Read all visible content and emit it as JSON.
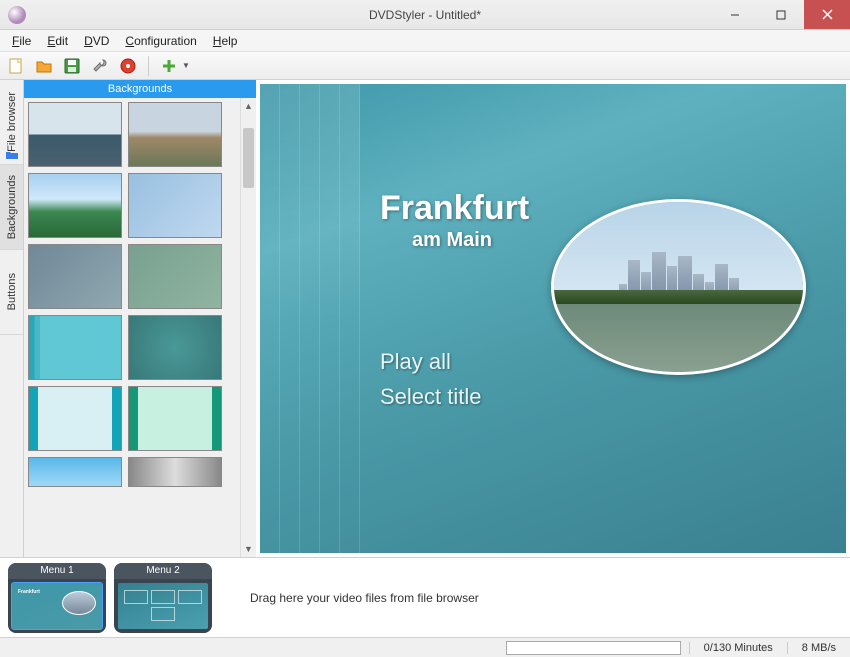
{
  "window": {
    "title": "DVDStyler - Untitled*"
  },
  "menubar": {
    "file": "File",
    "edit": "Edit",
    "dvd": "DVD",
    "config": "Configuration",
    "help": "Help"
  },
  "side_tabs": {
    "file_browser": "File browser",
    "backgrounds": "Backgrounds",
    "buttons": "Buttons"
  },
  "bg_panel": {
    "header": "Backgrounds"
  },
  "preview": {
    "title_main": "Frankfurt",
    "title_sub": "am Main",
    "play_all": "Play all",
    "select_title": "Select title"
  },
  "timeline": {
    "menu1": "Menu 1",
    "menu2": "Menu 2",
    "drag_hint": "Drag here your video files from file browser"
  },
  "status": {
    "minutes": "0/130 Minutes",
    "rate": "8 MB/s"
  },
  "toolbar_icons": {
    "new": "new-file-icon",
    "open": "open-folder-icon",
    "save": "save-icon",
    "settings": "wrench-icon",
    "burn": "burn-disc-icon",
    "add": "add-icon"
  }
}
